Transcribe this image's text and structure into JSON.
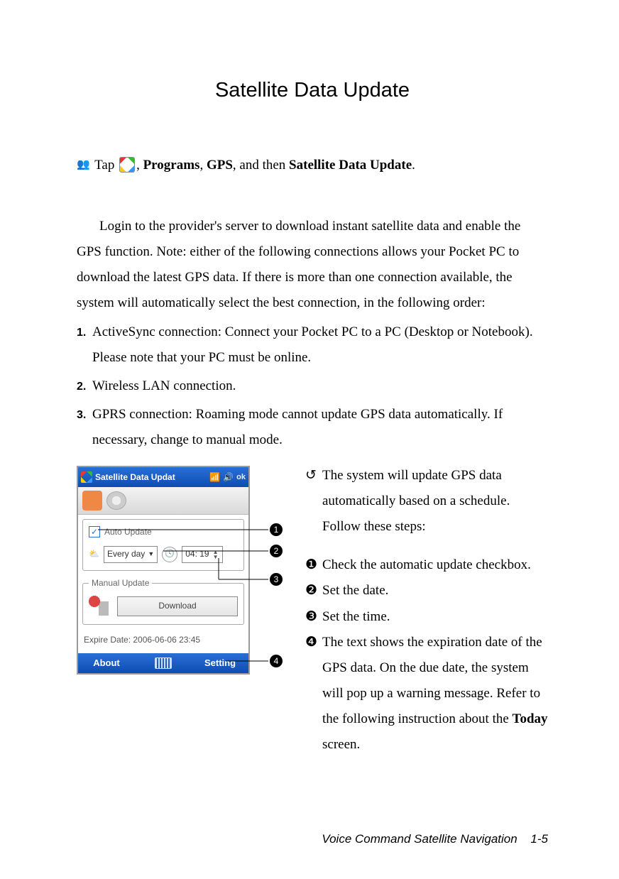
{
  "title": "Satellite Data Update",
  "nav": {
    "tap": "Tap",
    "programs": "Programs",
    "gps": "GPS",
    "then": "and then",
    "target": "Satellite Data Update",
    "comma": ", ",
    "period": "."
  },
  "intro": "Login to the provider's server to download instant satellite data and enable the GPS function. Note: either of the following connections allows your Pocket PC to download the latest GPS data. If there is more than one connection available, the system will automatically select the best connection, in the following order:",
  "connections": [
    "ActiveSync connection: Connect your Pocket PC to a PC (Desktop or Notebook). Please note that your PC must be online.",
    "Wireless LAN connection.",
    "GPRS connection: Roaming mode cannot update GPS data automatically. If necessary, change to manual mode."
  ],
  "screenshot": {
    "title": "Satellite Data Updat",
    "ok": "ok",
    "auto_group": "Auto Update",
    "auto_checked": true,
    "frequency": "Every day",
    "time": "04: 19",
    "manual_group": "Manual Update",
    "download": "Download",
    "expire": "Expire Date: 2006-06-06 23:45",
    "about": "About",
    "setting": "Setting"
  },
  "callout_labels": {
    "n1": "1",
    "n2": "2",
    "n3": "3",
    "n4": "4"
  },
  "desc": {
    "lead_marker": "↺",
    "lead": "The system will update GPS data automatically based on a schedule. Follow these steps:",
    "items": [
      {
        "marker": "❶",
        "text": "Check the automatic update checkbox."
      },
      {
        "marker": "❷",
        "text": "Set the date."
      },
      {
        "marker": "❸",
        "text": "Set the time."
      },
      {
        "marker": "❹",
        "text_pre": "The text shows the expiration date of the GPS data. On the due date, the system will pop up a warning message. Refer to the following instruction about the ",
        "bold": "Today",
        "text_post": " screen."
      }
    ]
  },
  "footer": {
    "section": "Voice Command Satellite Navigation",
    "page": "1-5"
  }
}
